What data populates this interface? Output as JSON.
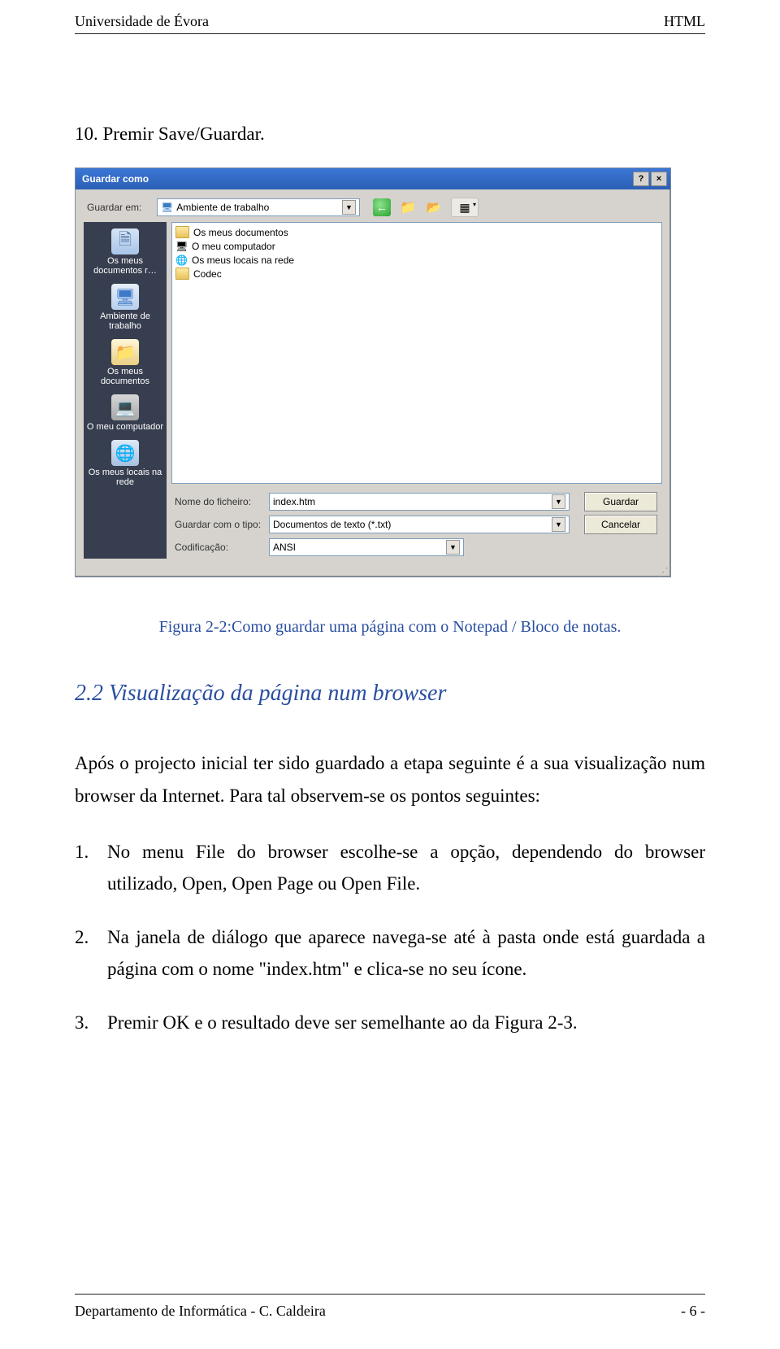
{
  "header": {
    "left": "Universidade de Évora",
    "right": "HTML"
  },
  "step_line": "10. Premir Save/Guardar.",
  "dialog": {
    "title": "Guardar como",
    "help_btn": "?",
    "close_btn": "×",
    "save_in_label": "Guardar em:",
    "save_in_value": "Ambiente de trabalho",
    "sidebar": [
      "Os meus documentos r…",
      "Ambiente de trabalho",
      "Os meus documentos",
      "O meu computador",
      "Os meus locais na rede"
    ],
    "listing": [
      "Os meus documentos",
      "O meu computador",
      "Os meus locais na rede",
      "Codec"
    ],
    "filename_label": "Nome do ficheiro:",
    "filename_value": "index.htm",
    "filetype_label": "Guardar com o tipo:",
    "filetype_value": "Documentos de texto (*.txt)",
    "encoding_label": "Codificação:",
    "encoding_value": "ANSI",
    "save_btn": "Guardar",
    "cancel_btn": "Cancelar"
  },
  "caption": "Figura 2-2:Como guardar uma página com o Notepad / Bloco de notas.",
  "section_heading": "2.2   Visualização da página num browser",
  "para1": "Após o projecto inicial ter sido guardado a etapa seguinte é a sua visualização num browser da Internet. Para tal observem-se os pontos seguintes:",
  "list": [
    "No menu File do browser escolhe-se a opção, dependendo do browser utilizado, Open, Open Page ou Open File.",
    "Na janela de diálogo que aparece navega-se até à pasta onde está guardada a página com o nome \"index.htm\" e clica-se no seu ícone.",
    "Premir OK e o resultado deve ser semelhante ao da Figura 2-3."
  ],
  "footer": {
    "left": "Departamento de Informática - C. Caldeira",
    "right": "- 6 -"
  }
}
